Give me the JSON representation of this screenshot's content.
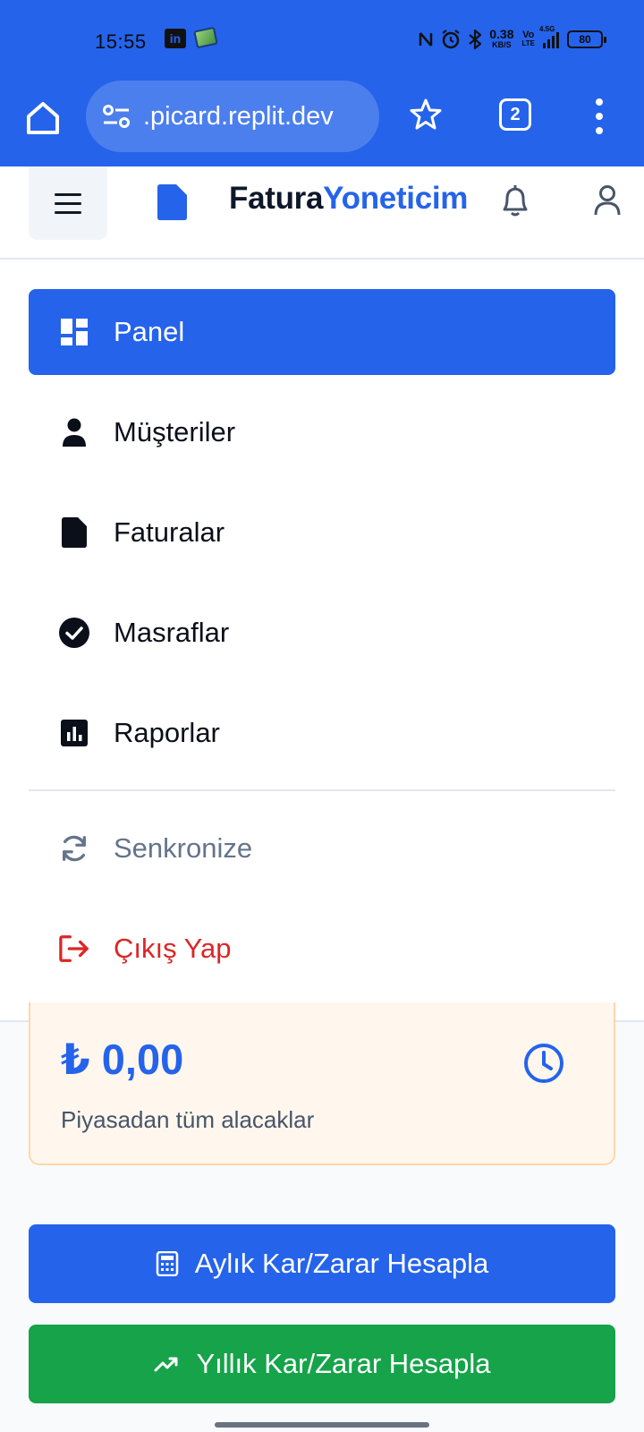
{
  "status_bar": {
    "time": "15:55",
    "network_speed_top": "0.38",
    "network_speed_bottom": "KB/S",
    "volte_top": "Vo",
    "volte_bottom": "LTE",
    "signal_label": "4.5G",
    "battery": "80"
  },
  "browser": {
    "url": ".picard.replit.dev",
    "tab_count": "2"
  },
  "header": {
    "brand_part1": "Fatura",
    "brand_part2": "Yoneticim"
  },
  "menu": {
    "items": [
      {
        "label": "Panel",
        "icon": "dashboard-icon",
        "active": true
      },
      {
        "label": "Müşteriler",
        "icon": "user-icon"
      },
      {
        "label": "Faturalar",
        "icon": "document-icon"
      },
      {
        "label": "Masraflar",
        "icon": "check-circle-icon"
      },
      {
        "label": "Raporlar",
        "icon": "bar-chart-icon"
      }
    ],
    "sync_label": "Senkronize",
    "logout_label": "Çıkış Yap"
  },
  "receivables_card": {
    "amount": "₺ 0,00",
    "description": "Piyasadan tüm alacaklar"
  },
  "actions": {
    "monthly_label": "Aylık Kar/Zarar Hesapla",
    "yearly_label": "Yıllık Kar/Zarar Hesapla"
  },
  "colors": {
    "primary": "#2563eb",
    "success": "#16a34a",
    "danger": "#dc2626",
    "card_bg": "#fff7ed"
  }
}
